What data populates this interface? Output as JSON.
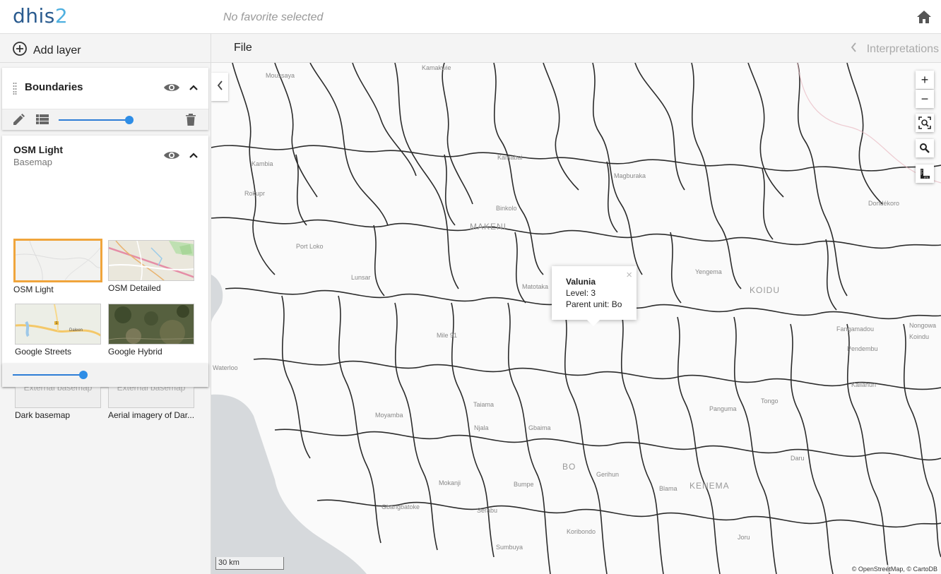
{
  "header": {
    "logo_main": "dhis",
    "logo_digit": "2",
    "favorite": "No favorite selected",
    "home_icon": "home-icon"
  },
  "toolbar": {
    "add_layer": "Add layer",
    "file": "File",
    "interpretations": "Interpretations"
  },
  "layers": {
    "boundaries": {
      "title": "Boundaries",
      "opacity": 1.0
    },
    "basemap": {
      "title": "OSM Light",
      "subtitle": "Basemap",
      "opacity": 0.75,
      "options": [
        {
          "label": "OSM Light",
          "selected": true,
          "thumb": "osm-light"
        },
        {
          "label": "OSM Detailed",
          "selected": false,
          "thumb": "osm-detailed"
        },
        {
          "label": "Google Streets",
          "selected": false,
          "thumb": "google-streets"
        },
        {
          "label": "Google Hybrid",
          "selected": false,
          "thumb": "google-hybrid"
        },
        {
          "label": "Dark basemap",
          "selected": false,
          "thumb": "external",
          "placeholder": "External basemap"
        },
        {
          "label": "Aerial imagery of Dar...",
          "selected": false,
          "thumb": "external",
          "placeholder": "External basemap"
        }
      ],
      "thumb_text": {
        "streets_town": "Daleen",
        "streets_road_num": "1"
      }
    }
  },
  "map": {
    "labels": [
      {
        "text": "Kamakwie",
        "big": false
      },
      {
        "text": "Moussaya",
        "big": false
      },
      {
        "text": "Kambia",
        "big": false
      },
      {
        "text": "Rokupr",
        "big": false
      },
      {
        "text": "Kamabai",
        "big": false
      },
      {
        "text": "Binkolo",
        "big": false
      },
      {
        "text": "MAKENI",
        "big": true
      },
      {
        "text": "Lunsar",
        "big": false
      },
      {
        "text": "Matotaka",
        "big": false
      },
      {
        "text": "Mile 91",
        "big": false
      },
      {
        "text": "Waterloo",
        "big": false
      },
      {
        "text": "Moyamba",
        "big": false
      },
      {
        "text": "Taiama",
        "big": false
      },
      {
        "text": "Njala",
        "big": false
      },
      {
        "text": "Gbaima",
        "big": false
      },
      {
        "text": "BO",
        "big": true
      },
      {
        "text": "Gerihun",
        "big": false
      },
      {
        "text": "Mokanji",
        "big": false
      },
      {
        "text": "Bumpe",
        "big": false
      },
      {
        "text": "Gbangbatoke",
        "big": false
      },
      {
        "text": "Serabu",
        "big": false
      },
      {
        "text": "Koribondo",
        "big": false
      },
      {
        "text": "Sumbuya",
        "big": false
      },
      {
        "text": "Blama",
        "big": false
      },
      {
        "text": "KENEMA",
        "big": true
      },
      {
        "text": "Tongo",
        "big": false
      },
      {
        "text": "Panguma",
        "big": false
      },
      {
        "text": "Joru",
        "big": false
      },
      {
        "text": "Daru",
        "big": false
      },
      {
        "text": "Kailahun",
        "big": false
      },
      {
        "text": "Pendembu",
        "big": false
      },
      {
        "text": "KOIDU",
        "big": true
      },
      {
        "text": "Yengema",
        "big": false
      },
      {
        "text": "Dondékoro",
        "big": false
      },
      {
        "text": "Fangamadou",
        "big": false
      },
      {
        "text": "Nongowa",
        "big": false
      },
      {
        "text": "Koindu",
        "big": false
      },
      {
        "text": "Magburaka",
        "big": false
      },
      {
        "text": "Port Loko",
        "big": false
      }
    ],
    "popup": {
      "name": "Valunia",
      "level": "Level: 3",
      "parent": "Parent unit: Bo",
      "close": "×"
    },
    "scale": "30 km",
    "attribution": "© OpenStreetMap, © CartoDB",
    "controls": {
      "zoom_in": "+",
      "zoom_out": "−"
    }
  }
}
